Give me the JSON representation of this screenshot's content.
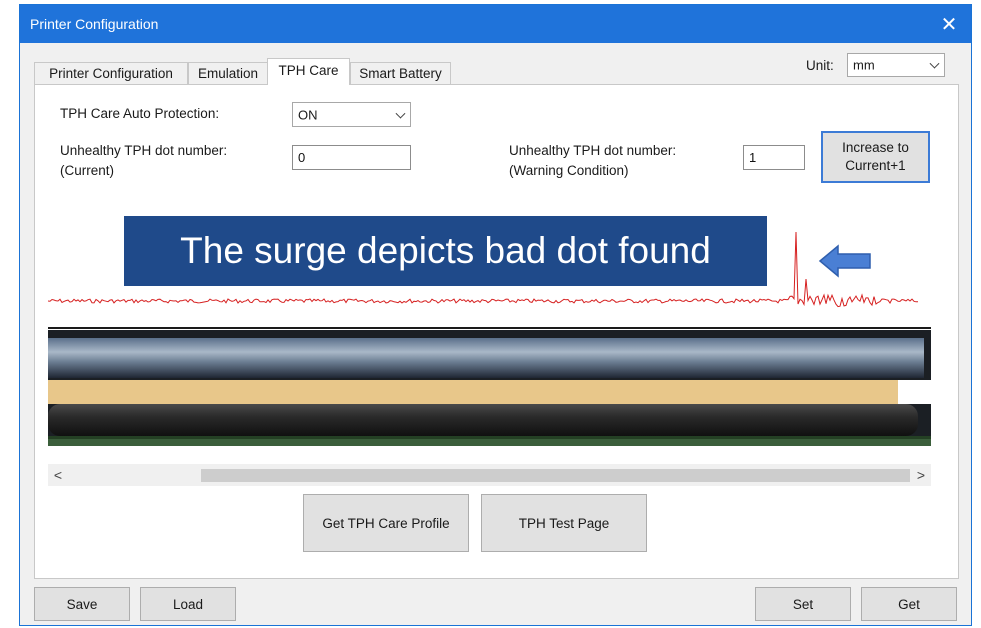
{
  "window": {
    "title": "Printer Configuration",
    "close_icon": "close-icon"
  },
  "tabs": [
    {
      "label": "Printer Configuration",
      "active": false
    },
    {
      "label": "Emulation",
      "active": false
    },
    {
      "label": "TPH Care",
      "active": true
    },
    {
      "label": "Smart Battery",
      "active": false
    }
  ],
  "unit": {
    "label": "Unit:",
    "value": "mm"
  },
  "tph_care": {
    "auto_protection_label": "TPH Care Auto Protection:",
    "auto_protection_value": "ON",
    "current_label_line1": "Unhealthy TPH dot number:",
    "current_label_line2": "(Current)",
    "current_value": "0",
    "warning_label_line1": "Unhealthy TPH dot number:",
    "warning_label_line2": "(Warning Condition)",
    "warning_value": "1",
    "increase_line1": "Increase to",
    "increase_line2": "Current+1"
  },
  "graph": {
    "annotation": "The surge depicts bad dot found",
    "arrow_icon": "left-arrow-icon",
    "line_color": "#d62020",
    "annotation_color": "#1f4a8a"
  },
  "scroll": {
    "left_arrow": "<",
    "right_arrow": ">"
  },
  "actions": {
    "get_profile": "Get TPH Care Profile",
    "test_page": "TPH Test Page"
  },
  "footer": {
    "save": "Save",
    "load": "Load",
    "set": "Set",
    "get": "Get"
  }
}
